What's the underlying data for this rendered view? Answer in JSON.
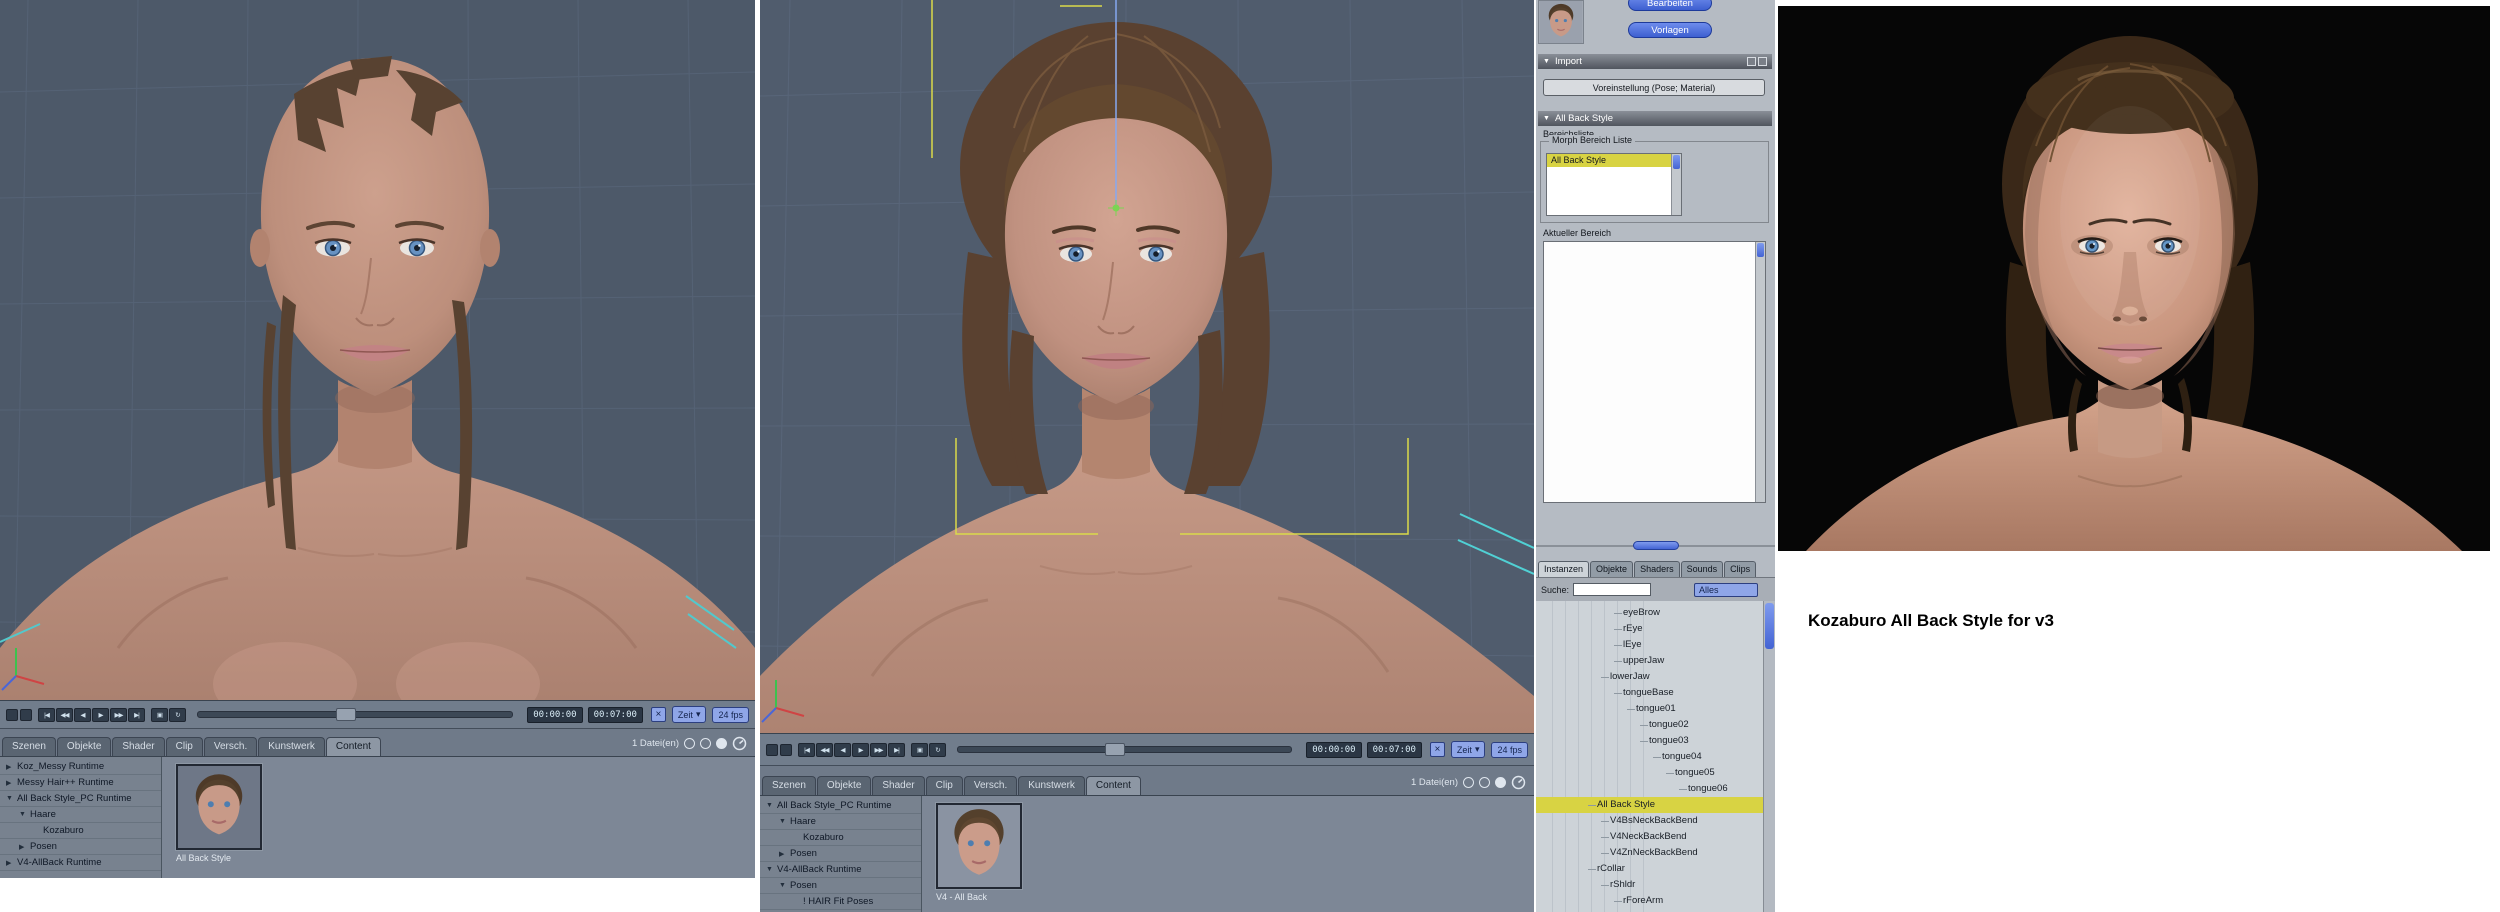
{
  "glyphs": {
    "close": "×",
    "dropdown": "▾"
  },
  "icons": {
    "transport": [
      "|◀",
      "◀◀",
      "◀",
      "▶",
      "▶▶",
      "▶|"
    ],
    "aux": [
      "▣",
      "↻"
    ]
  },
  "left": {
    "timeline": {
      "t1": "00:00:00",
      "t2": "00:07:00",
      "mode": "Zeit",
      "fps": "24 fps"
    },
    "tabs": [
      {
        "label": "Szenen"
      },
      {
        "label": "Objekte"
      },
      {
        "label": "Shader"
      },
      {
        "label": "Clip"
      },
      {
        "label": "Versch."
      },
      {
        "label": "Kunstwerk"
      },
      {
        "label": "Content",
        "active": true
      }
    ],
    "file_count": "1 Datei(en)",
    "tree": [
      {
        "label": "Koz_Messy Runtime",
        "arrow": "▶",
        "indent": 0
      },
      {
        "label": "Messy Hair++ Runtime",
        "arrow": "▶",
        "indent": 0
      },
      {
        "label": "All Back Style_PC Runtime",
        "arrow": "▼",
        "indent": 0
      },
      {
        "label": "Haare",
        "arrow": "▼",
        "indent": 1
      },
      {
        "label": "Kozaburo",
        "arrow": "",
        "indent": 2
      },
      {
        "label": "Posen",
        "arrow": "▶",
        "indent": 1
      },
      {
        "label": "V4-AllBack Runtime",
        "arrow": "▶",
        "indent": 0
      }
    ],
    "thumb_caption": "All Back Style"
  },
  "mid": {
    "timeline": {
      "t1": "00:00:00",
      "t2": "00:07:00",
      "mode": "Zeit",
      "fps": "24 fps"
    },
    "tabs": [
      {
        "label": "Szenen"
      },
      {
        "label": "Objekte"
      },
      {
        "label": "Shader"
      },
      {
        "label": "Clip"
      },
      {
        "label": "Versch."
      },
      {
        "label": "Kunstwerk"
      },
      {
        "label": "Content",
        "active": true
      }
    ],
    "file_count": "1 Datei(en)",
    "tree": [
      {
        "label": "All Back Style_PC Runtime",
        "arrow": "▼",
        "indent": 0
      },
      {
        "label": "Haare",
        "arrow": "▼",
        "indent": 1
      },
      {
        "label": "Kozaburo",
        "arrow": "",
        "indent": 2
      },
      {
        "label": "Posen",
        "arrow": "▶",
        "indent": 1
      },
      {
        "label": "V4-AllBack Runtime",
        "arrow": "▼",
        "indent": 0
      },
      {
        "label": "Posen",
        "arrow": "▼",
        "indent": 1
      },
      {
        "label": "! HAIR Fit Poses",
        "arrow": "",
        "indent": 2
      }
    ],
    "thumb_caption": "V4 - All Back"
  },
  "props": {
    "buttons": {
      "edit": "Bearbeiten",
      "templates": "Vorlagen",
      "preset": "Voreinstellung (Pose; Material)"
    },
    "sections": {
      "import": "Import",
      "style": "All Back Style"
    },
    "labels": {
      "area_list": "Bereichsliste",
      "morph_list": "Morph Bereich Liste",
      "current_area": "Aktueller Bereich",
      "search": "Suche:"
    },
    "morph_items": [
      {
        "label": "All Back Style",
        "selected": true
      }
    ],
    "filter": "Alles",
    "tabs": [
      {
        "label": "Instanzen",
        "active": true
      },
      {
        "label": "Objekte"
      },
      {
        "label": "Shaders"
      },
      {
        "label": "Sounds"
      },
      {
        "label": "Clips"
      }
    ],
    "tree": [
      {
        "label": "eyeBrow",
        "indent": 3
      },
      {
        "label": "rEye",
        "indent": 3
      },
      {
        "label": "lEye",
        "indent": 3
      },
      {
        "label": "upperJaw",
        "indent": 3
      },
      {
        "label": "lowerJaw",
        "indent": 2
      },
      {
        "label": "tongueBase",
        "indent": 3
      },
      {
        "label": "tongue01",
        "indent": 4
      },
      {
        "label": "tongue02",
        "indent": 5
      },
      {
        "label": "tongue03",
        "indent": 5
      },
      {
        "label": "tongue04",
        "indent": 6
      },
      {
        "label": "tongue05",
        "indent": 7
      },
      {
        "label": "tongue06",
        "indent": 8
      },
      {
        "label": "All Back Style",
        "indent": 1,
        "selected": true
      },
      {
        "label": "V4BsNeckBackBend",
        "indent": 2
      },
      {
        "label": "V4NeckBackBend",
        "indent": 2
      },
      {
        "label": "V4ZnNeckBackBend",
        "indent": 2
      },
      {
        "label": "rCollar",
        "indent": 1
      },
      {
        "label": "rShldr",
        "indent": 2
      },
      {
        "label": "rForeArm",
        "indent": 3
      }
    ]
  },
  "render": {
    "caption": "Kozaburo All Back Style for v3"
  }
}
